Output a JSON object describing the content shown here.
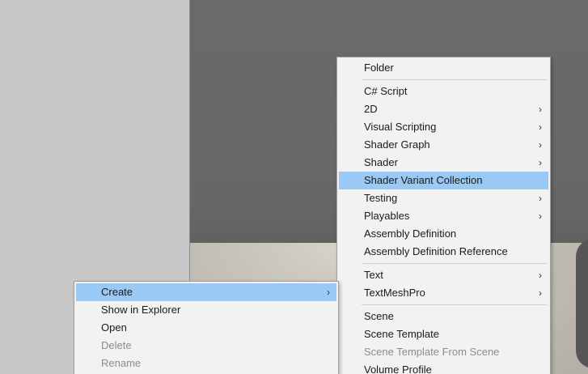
{
  "create_menu": {
    "items": [
      {
        "label": "Folder",
        "arrow": ""
      },
      {
        "label": "C# Script",
        "arrow": ""
      },
      {
        "label": "2D",
        "arrow": "›"
      },
      {
        "label": "Visual Scripting",
        "arrow": "›"
      },
      {
        "label": "Shader Graph",
        "arrow": "›"
      },
      {
        "label": "Shader",
        "arrow": "›"
      },
      {
        "label": "Shader Variant Collection",
        "arrow": ""
      },
      {
        "label": "Testing",
        "arrow": "›"
      },
      {
        "label": "Playables",
        "arrow": "›"
      },
      {
        "label": "Assembly Definition",
        "arrow": ""
      },
      {
        "label": "Assembly Definition Reference",
        "arrow": ""
      },
      {
        "label": "Text",
        "arrow": "›"
      },
      {
        "label": "TextMeshPro",
        "arrow": "›"
      },
      {
        "label": "Scene",
        "arrow": ""
      },
      {
        "label": "Scene Template",
        "arrow": ""
      },
      {
        "label": "Scene Template From Scene",
        "arrow": ""
      },
      {
        "label": "Volume Profile",
        "arrow": ""
      }
    ]
  },
  "context_menu": {
    "items": [
      {
        "label": "Create",
        "arrow": "›"
      },
      {
        "label": "Show in Explorer",
        "arrow": ""
      },
      {
        "label": "Open",
        "arrow": ""
      },
      {
        "label": "Delete",
        "arrow": ""
      },
      {
        "label": "Rename",
        "arrow": ""
      }
    ]
  },
  "colors": {
    "highlight": "#99c9f5",
    "menu_bg": "#f2f2f2",
    "disabled_text": "#8c8c8c"
  }
}
